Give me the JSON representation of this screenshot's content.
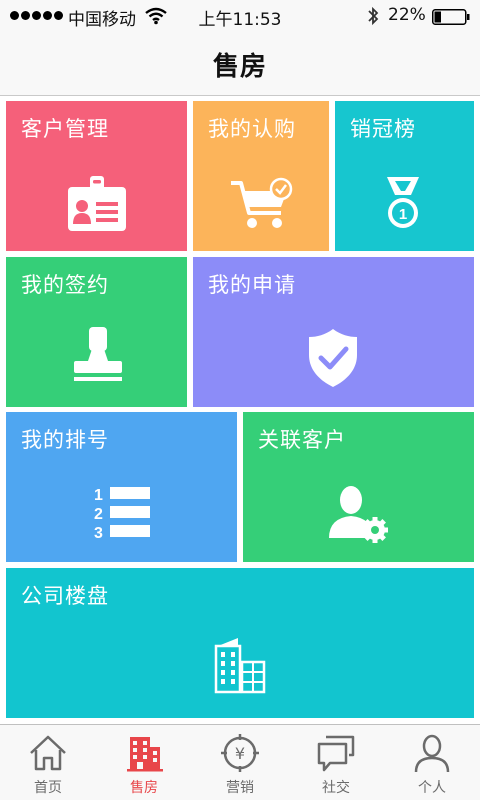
{
  "status_bar": {
    "carrier": "中国移动",
    "time": "上午11:53",
    "battery": "22%",
    "battery_level": 0.22
  },
  "nav": {
    "title": "售房"
  },
  "tiles": [
    {
      "label": "客户管理",
      "icon": "id-badge-icon",
      "color": "#f5607a"
    },
    {
      "label": "我的认购",
      "icon": "shopping-cart-check-icon",
      "color": "#fcb45a"
    },
    {
      "label": "销冠榜",
      "icon": "medal-icon",
      "color": "#17c6cf"
    },
    {
      "label": "我的签约",
      "icon": "stamp-icon",
      "color": "#35cf78"
    },
    {
      "label": "我的申请",
      "icon": "shield-check-icon",
      "color": "#8c8cf8"
    },
    {
      "label": "我的排号",
      "icon": "numbered-list-icon",
      "color": "#4fa6f1"
    },
    {
      "label": "关联客户",
      "icon": "user-gear-icon",
      "color": "#35cf78"
    },
    {
      "label": "公司楼盘",
      "icon": "buildings-icon",
      "color": "#12c5cf"
    }
  ],
  "tab_bar": {
    "tabs": [
      {
        "label": "首页",
        "icon": "home-icon",
        "active": false
      },
      {
        "label": "售房",
        "icon": "building-icon",
        "active": true
      },
      {
        "label": "营销",
        "icon": "yen-target-icon",
        "active": false
      },
      {
        "label": "社交",
        "icon": "chat-bubbles-icon",
        "active": false
      },
      {
        "label": "个人",
        "icon": "person-icon",
        "active": false
      }
    ],
    "active_color": "#e8464a",
    "inactive_color": "#6b6b6b"
  }
}
